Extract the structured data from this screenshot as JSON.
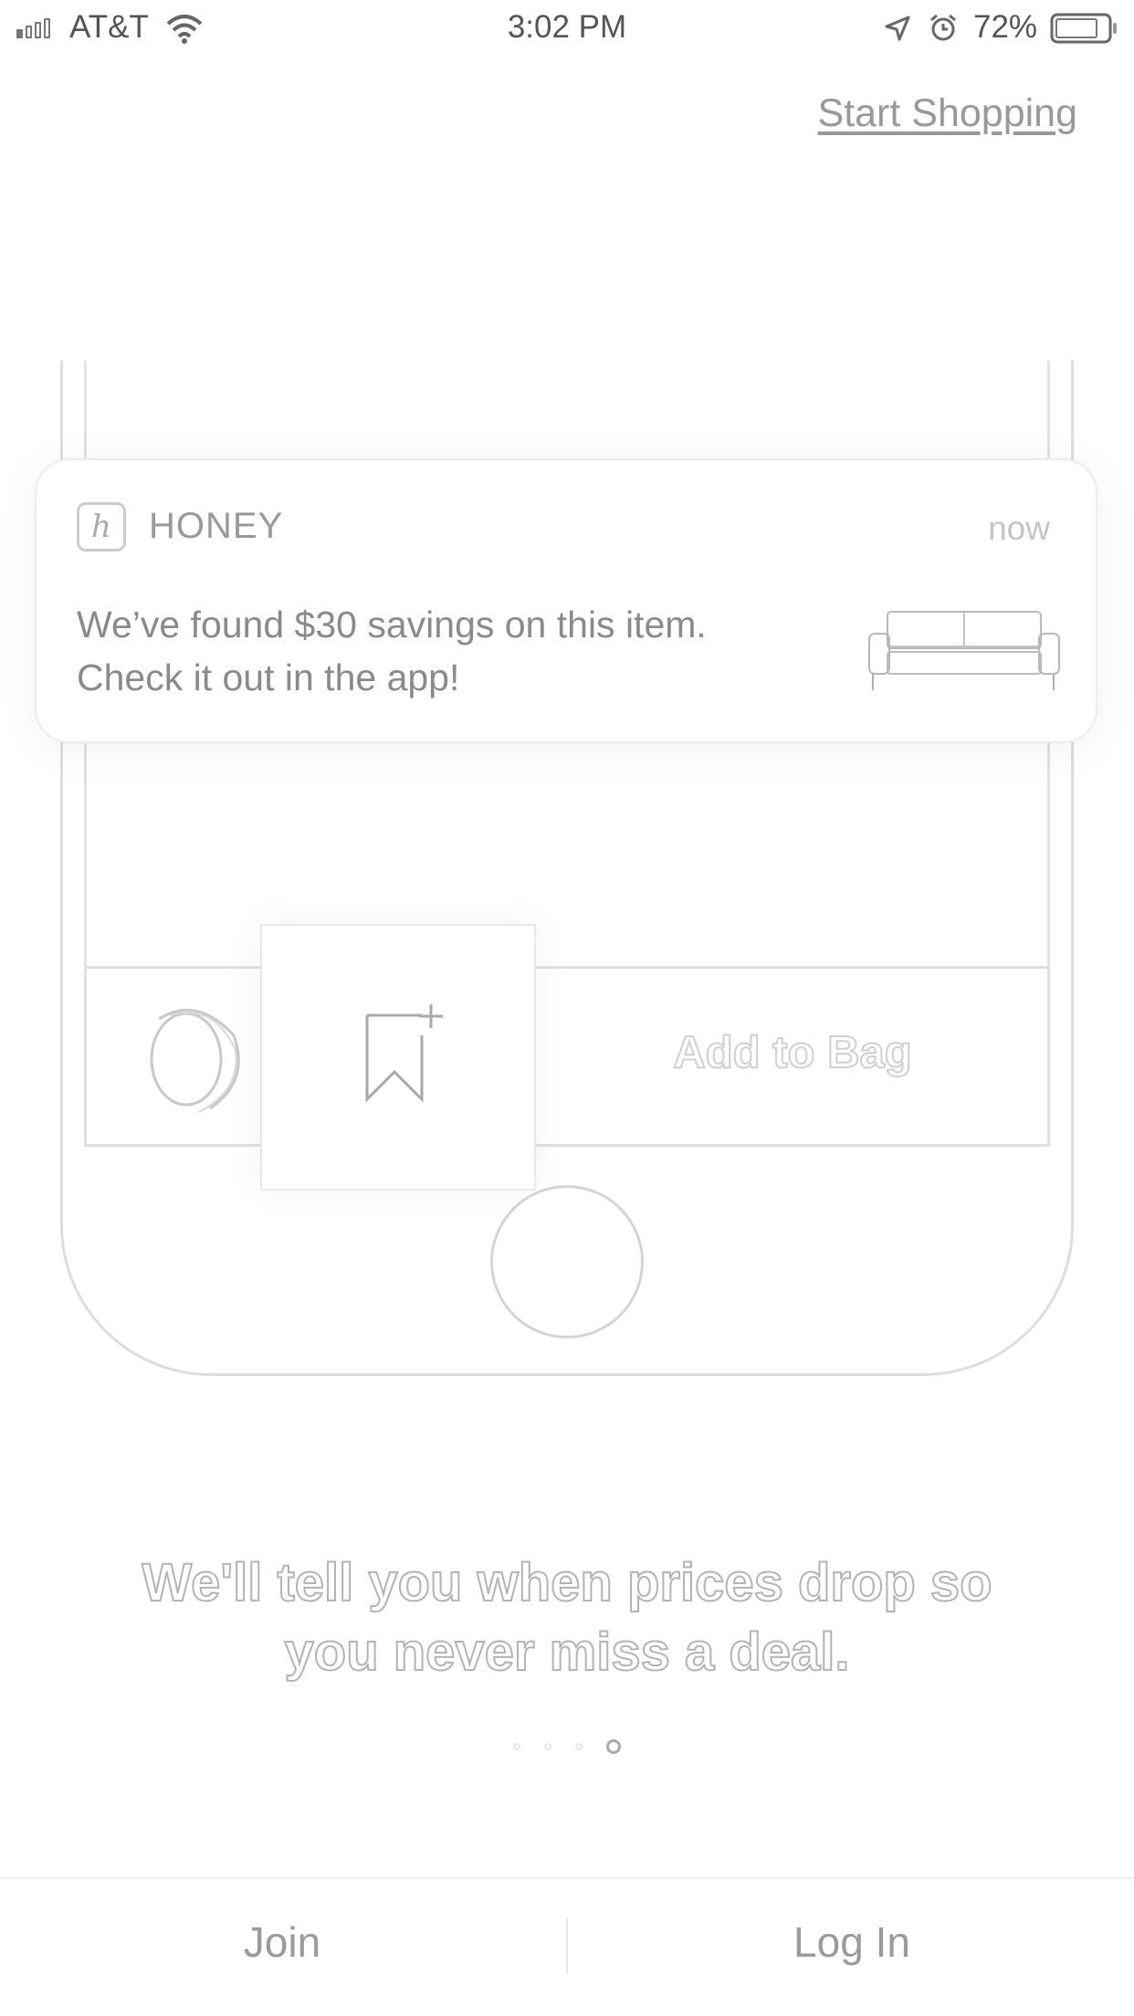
{
  "status_bar": {
    "carrier": "AT&T",
    "time": "3:02 PM",
    "battery_percent": "72%",
    "icons": [
      "signal-icon",
      "wifi-icon",
      "location-arrow-icon",
      "alarm-icon",
      "battery-icon"
    ]
  },
  "header": {
    "start_shopping": "Start Shopping"
  },
  "notification": {
    "app_icon_letter": "h",
    "app_name": "HONEY",
    "time": "now",
    "message_line1": "We’ve found $30 savings on this item.",
    "message_line2": "Check it out in the app!",
    "thumbnail": "sofa-icon"
  },
  "phone_mockup": {
    "add_to_bag": "Add to Bag",
    "icons": [
      "honey-ring-icon",
      "bookmark-add-icon"
    ]
  },
  "onboarding": {
    "tagline_line1": "We'll tell you when prices drop so",
    "tagline_line2": "you never miss a deal.",
    "page_count": 4,
    "active_page": 4
  },
  "bottom_bar": {
    "join": "Join",
    "log_in": "Log In"
  },
  "colors": {
    "background": "#ffffff",
    "outline": "#dddddd",
    "text": "#8a8a8a"
  }
}
